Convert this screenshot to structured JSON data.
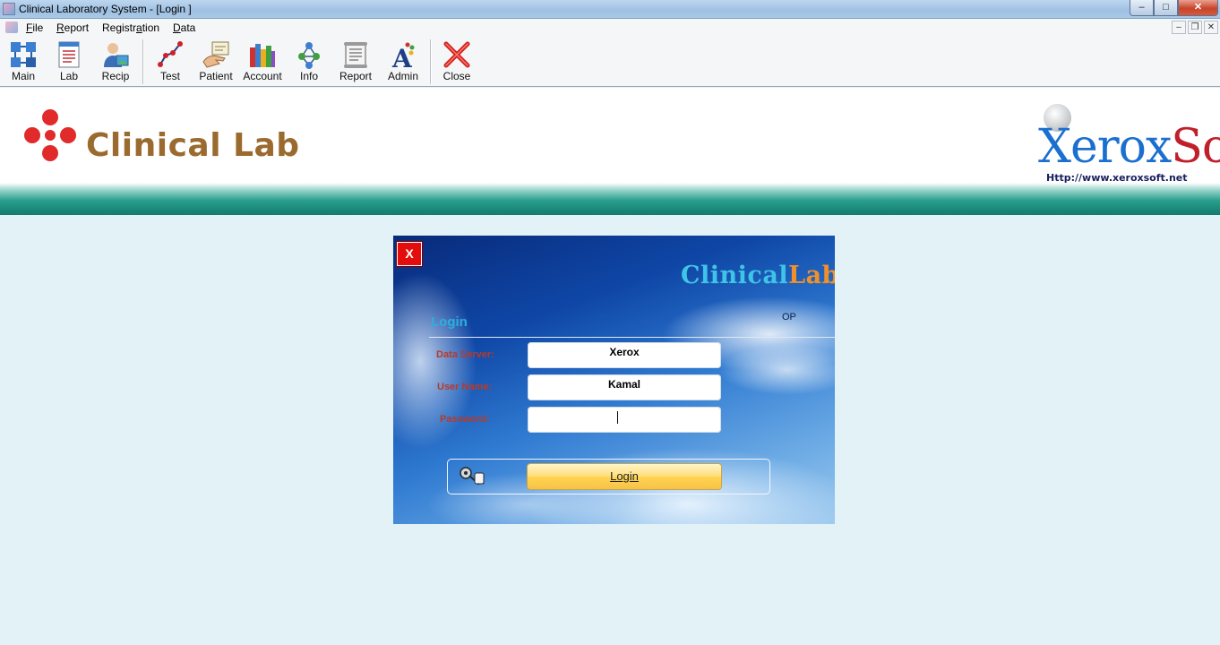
{
  "window": {
    "title": "Clinical Laboratory System - [Login ]",
    "controls": {
      "minimize": "–",
      "maximize": "□",
      "close": "✕"
    },
    "mdi_controls": {
      "minimize": "–",
      "restore": "❐",
      "close": "✕"
    }
  },
  "menu": {
    "items": [
      {
        "label": "File"
      },
      {
        "label": "Report"
      },
      {
        "label": "Registration"
      },
      {
        "label": "Data"
      }
    ]
  },
  "toolbar": {
    "buttons": [
      {
        "label": "Main",
        "icon": "main-grid-icon"
      },
      {
        "label": "Lab",
        "icon": "lab-document-icon"
      },
      {
        "label": "Recip",
        "icon": "recip-person-icon"
      },
      {
        "label": "Test",
        "icon": "test-graph-icon"
      },
      {
        "label": "Patient",
        "icon": "patient-hand-icon"
      },
      {
        "label": "Account",
        "icon": "account-books-icon"
      },
      {
        "label": "Info",
        "icon": "info-network-icon"
      },
      {
        "label": "Report",
        "icon": "report-scroll-icon"
      },
      {
        "label": "Admin",
        "icon": "admin-letter-icon"
      },
      {
        "label": "Close",
        "icon": "close-x-icon"
      }
    ]
  },
  "banner": {
    "app_name": "Clinical Lab",
    "vendor": {
      "name_part1": "Xerox",
      "name_part2": "Soft",
      "url": "Http://www.xeroxsoft.net"
    },
    "colors": {
      "app_name": "#9b6a2e",
      "band": "#1e8a7a",
      "vendor_blue": "#1a6fcf",
      "vendor_red": "#c0202a"
    }
  },
  "login": {
    "close_label": "X",
    "brand_part1": "Clinical",
    "brand_part2": "Lab",
    "title": "Login",
    "op_text": "OP",
    "fields": {
      "data_server": {
        "label": "Data Server:",
        "value": "Xerox"
      },
      "user_name": {
        "label": "User Name:",
        "value": "Kamal"
      },
      "password": {
        "label": "Password:",
        "value": ""
      }
    },
    "login_button": "Login",
    "colors": {
      "label": "#b83a2a",
      "title": "#2ab0e0",
      "button": "#ffd34e",
      "close": "#e40d0d"
    }
  }
}
